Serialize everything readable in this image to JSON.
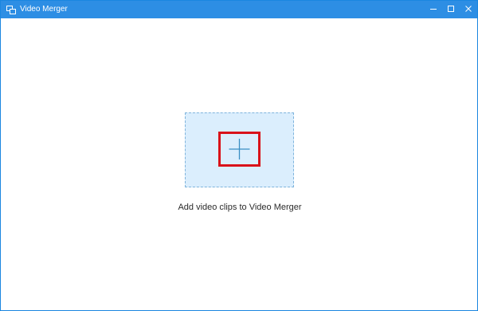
{
  "window": {
    "title": "Video Merger",
    "accent_color": "#2d8ee4",
    "controls": {
      "minimize_icon": "minimize-icon",
      "maximize_icon": "maximize-icon",
      "close_icon": "close-icon"
    }
  },
  "main": {
    "drop_zone": {
      "icon": "plus-icon",
      "highlight_color": "#d9121a",
      "fill_color": "#dbeefd"
    },
    "hint_text": "Add video clips to Video Merger"
  }
}
